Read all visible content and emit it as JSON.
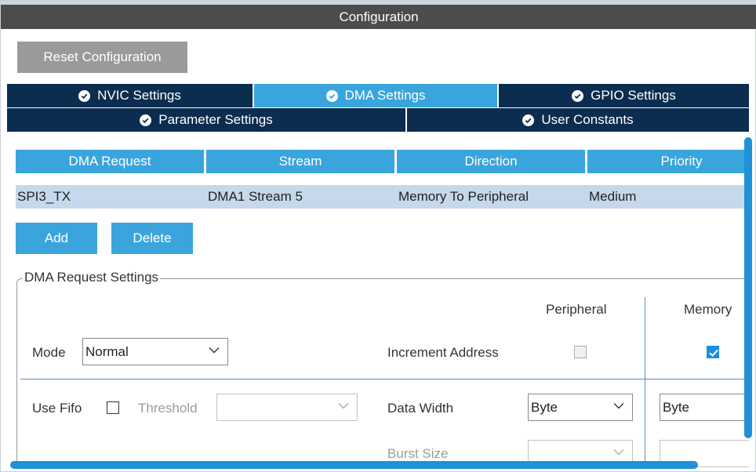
{
  "window": {
    "title": "Configuration"
  },
  "toolbar": {
    "reset_label": "Reset Configuration"
  },
  "tabs_row1": [
    {
      "label": "NVIC Settings",
      "active": false
    },
    {
      "label": "DMA Settings",
      "active": true
    },
    {
      "label": "GPIO Settings",
      "active": false
    }
  ],
  "tabs_row2": [
    {
      "label": "Parameter Settings"
    },
    {
      "label": "User Constants"
    }
  ],
  "table": {
    "headers": [
      "DMA Request",
      "Stream",
      "Direction",
      "Priority"
    ],
    "rows": [
      [
        "SPI3_TX",
        "DMA1 Stream 5",
        "Memory To Peripheral",
        "Medium"
      ]
    ]
  },
  "actions": {
    "add_label": "Add",
    "delete_label": "Delete"
  },
  "settings": {
    "legend": "DMA Request Settings",
    "mode_label": "Mode",
    "mode_value": "Normal",
    "use_fifo_label": "Use Fifo",
    "use_fifo_checked": false,
    "threshold_label": "Threshold",
    "threshold_value": "",
    "peripheral_header": "Peripheral",
    "memory_header": "Memory",
    "increment_label": "Increment Address",
    "increment_peripheral_checked": false,
    "increment_memory_checked": true,
    "data_width_label": "Data Width",
    "data_width_peripheral": "Byte",
    "data_width_memory": "Byte",
    "burst_size_label": "Burst Size",
    "burst_size_peripheral": "",
    "burst_size_memory": ""
  },
  "colors": {
    "accent": "#3aa5dc",
    "tab_dark": "#0b2d4f",
    "row_selected": "#c5d8ec",
    "title_bar": "#4c4c4c"
  }
}
